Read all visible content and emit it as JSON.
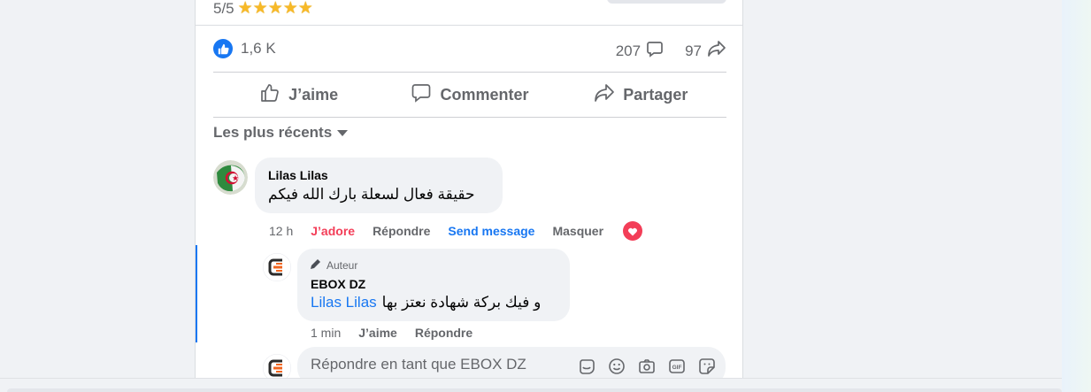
{
  "post": {
    "rating_text": "5/5",
    "stars": "★★★★★",
    "reactions_count": "1,6 K",
    "comments_count": "207",
    "shares_count": "97"
  },
  "actions": {
    "like": "J’aime",
    "comment": "Commenter",
    "share": "Partager"
  },
  "sort": {
    "label": "Les plus récents"
  },
  "comment1": {
    "author": "Lilas Lilas",
    "text": "حقيقة فعال لسعلة بارك الله فيكم",
    "time": "12 h",
    "reaction": "J’adore",
    "reply": "Répondre",
    "send_message": "Send message",
    "hide": "Masquer"
  },
  "reply1": {
    "badge": "Auteur",
    "author": "EBOX DZ",
    "mention": "Lilas Lilas",
    "text": "و فيك بركة شهادة نعتز بها",
    "time": "1 min",
    "like": "J’aime",
    "reply": "Répondre"
  },
  "composer": {
    "placeholder": "Répondre en tant que EBOX DZ"
  },
  "icons": {
    "like_badge": "thumbs-up-icon",
    "comment": "comment-bubble-icon",
    "share": "share-arrow-icon",
    "heart": "heart-icon",
    "pen": "pen-icon"
  },
  "colors": {
    "accent": "#1877f2",
    "love": "#f33e58",
    "muted": "#65676b"
  }
}
